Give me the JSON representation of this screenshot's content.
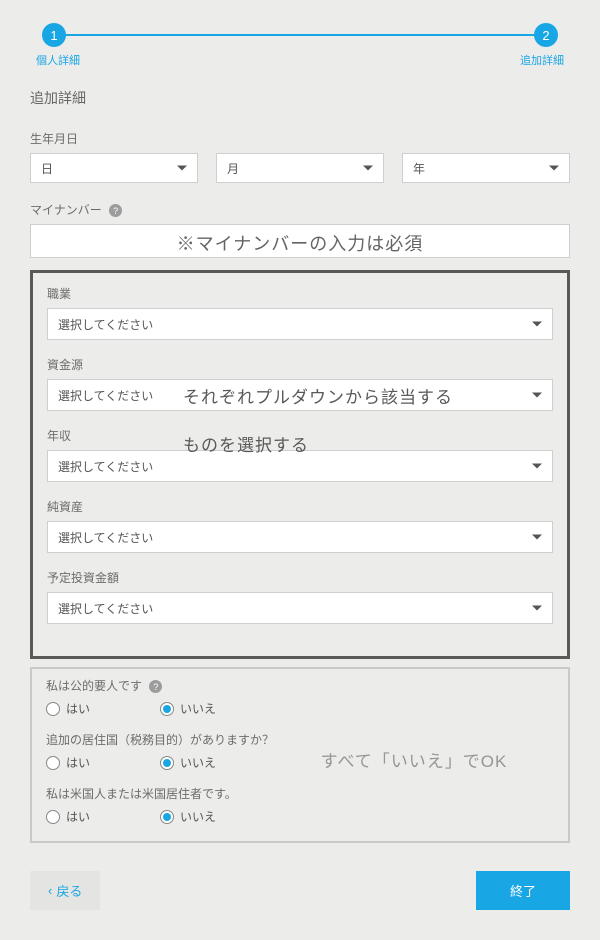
{
  "stepper": {
    "step1_num": "1",
    "step2_num": "2",
    "step1_label": "個人詳細",
    "step2_label": "追加詳細"
  },
  "section_title": "追加詳細",
  "dob": {
    "label": "生年月日",
    "day": "日",
    "month": "月",
    "year": "年"
  },
  "mynumber": {
    "label": "マイナンバー",
    "annotation": "※マイナンバーの入力は必須"
  },
  "financials": {
    "occupation": {
      "label": "職業",
      "value": "選択してください"
    },
    "source": {
      "label": "資金源",
      "value": "選択してください"
    },
    "income": {
      "label": "年収",
      "value": "選択してください"
    },
    "netassets": {
      "label": "純資産",
      "value": "選択してください"
    },
    "planned": {
      "label": "予定投資金額",
      "value": "選択してください"
    },
    "annotation_line1": "それぞれプルダウンから該当する",
    "annotation_line2": "ものを選択する"
  },
  "questions": {
    "pep": {
      "label": "私は公的要人です",
      "yes": "はい",
      "no": "いいえ",
      "selected": "no"
    },
    "taxres": {
      "label": "追加の居住国（税務目的）がありますか？",
      "yes": "はい",
      "no": "いいえ",
      "selected": "no"
    },
    "usperson": {
      "label": "私は米国人または米国居住者です。",
      "yes": "はい",
      "no": "いいえ",
      "selected": "no"
    },
    "annotation": "すべて「いいえ」でOK"
  },
  "buttons": {
    "back": "戻る",
    "finish": "終了"
  }
}
